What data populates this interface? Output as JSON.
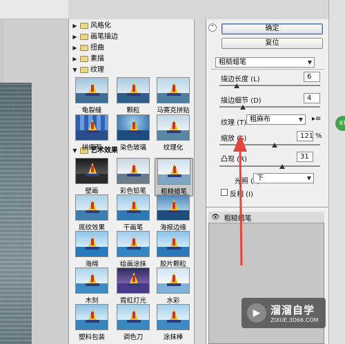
{
  "gallery": {
    "folders_top": [
      {
        "label": "风格化"
      },
      {
        "label": "画笔描边"
      },
      {
        "label": "扭曲"
      },
      {
        "label": "素描"
      }
    ],
    "texture_folder": "纹理",
    "texture_items": [
      "龟裂缝",
      "颗粒",
      "马赛克拼贴",
      "拼缀图",
      "染色玻璃",
      "纹理化"
    ],
    "artistic_folder": "艺术效果",
    "artistic_items": [
      "壁画",
      "彩色铅笔",
      "粗糙蜡笔",
      "底纹效果",
      "干画笔",
      "海报边缘",
      "海绵",
      "绘画涂抹",
      "胶片颗粒",
      "木刻",
      "霓虹灯光",
      "水彩",
      "塑料包装",
      "调色刀",
      "涂抹棒"
    ],
    "selected": "粗糙蜡笔"
  },
  "panel": {
    "ok_label": "确定",
    "reset_label": "复位",
    "filter_select": "粗糙蜡笔",
    "stroke_length_label": "描边长度 (L)",
    "stroke_length_value": "6",
    "stroke_detail_label": "描边细节 (D)",
    "stroke_detail_value": "4",
    "texture_label": "纹理 (T):",
    "texture_value": "粗麻布",
    "scaling_label": "缩放 (S)",
    "scaling_value": "121",
    "scaling_unit": "%",
    "relief_label": "凸现 (R)",
    "relief_value": "31",
    "light_label": "光照 (L):",
    "light_value": "下",
    "invert_label": "反相 (I)",
    "stroke_length_level": 0.17,
    "stroke_detail_level": 0.23,
    "scaling_level": 0.55,
    "relief_level": 0.62
  },
  "layers": {
    "row_label": "粗糙蜡笔"
  },
  "watermark": {
    "title": "溜溜自学",
    "sub": "ZIXUE.3D66.COM"
  },
  "badge": "61"
}
